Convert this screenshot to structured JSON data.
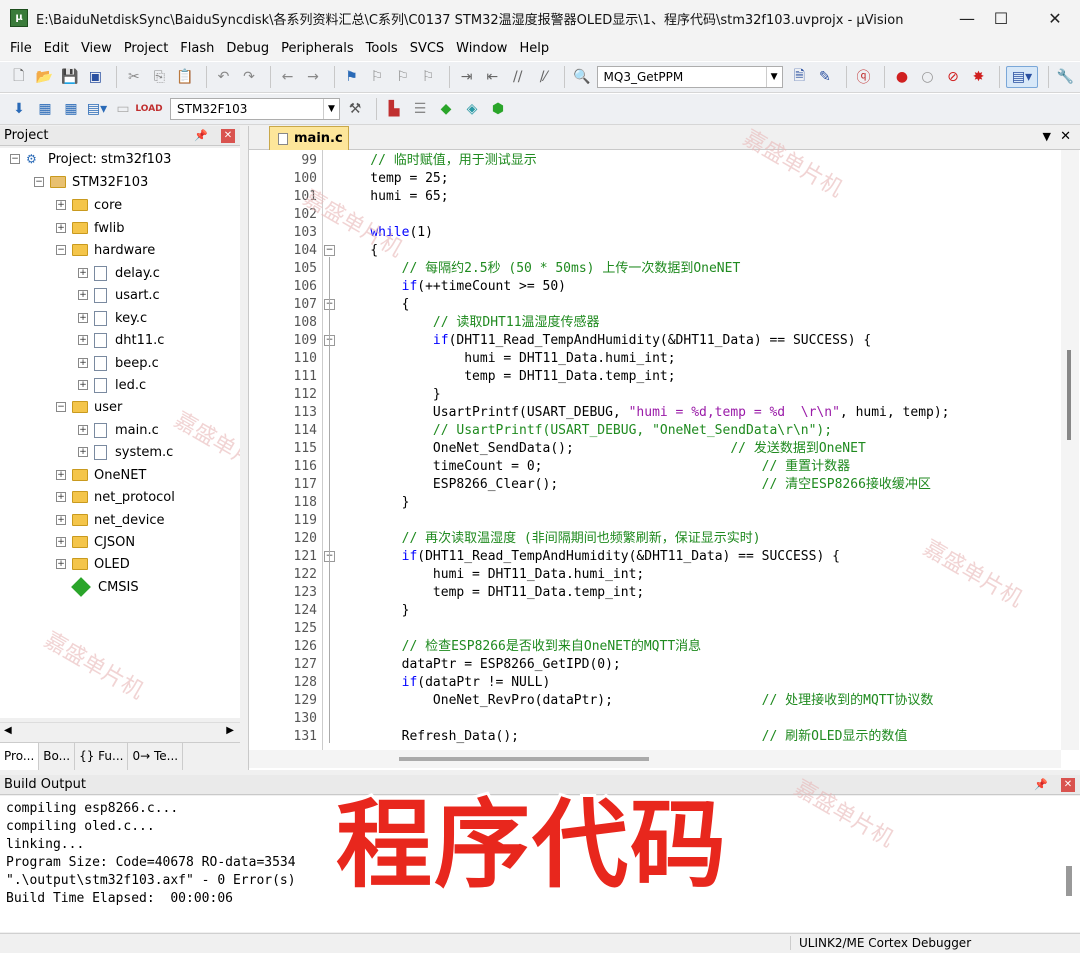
{
  "window": {
    "title": "E:\\BaiduNetdiskSync\\BaiduSyncdisk\\各系列资料汇总\\C系列\\C0137 STM32温湿度报警器OLED显示\\1、程序代码\\stm32f103.uvprojx - µVision",
    "minimize": "—",
    "maximize": "☐",
    "close": "✕"
  },
  "menu": [
    "File",
    "Edit",
    "View",
    "Project",
    "Flash",
    "Debug",
    "Peripherals",
    "Tools",
    "SVCS",
    "Window",
    "Help"
  ],
  "toolbar": {
    "find_combo": "MQ3_GetPPM",
    "target_combo": "STM32F103"
  },
  "project_panel": {
    "title": "Project",
    "root": "Project: stm32f103",
    "target": "STM32F103",
    "groups": {
      "core": "core",
      "fwlib": "fwlib",
      "hardware": "hardware",
      "hardware_files": [
        "delay.c",
        "usart.c",
        "key.c",
        "dht11.c",
        "beep.c",
        "led.c"
      ],
      "user": "user",
      "user_files": [
        "main.c",
        "system.c"
      ],
      "onenet": "OneNET",
      "net_protocol": "net_protocol",
      "net_device": "net_device",
      "cjson": "CJSON",
      "oled": "OLED",
      "cmsis": "CMSIS"
    },
    "tabs": [
      "Pro...",
      "Bo...",
      "{} Fu...",
      "0→ Te..."
    ]
  },
  "editor": {
    "tab": "main.c",
    "lines": [
      {
        "n": "99",
        "t": "    // 临时赋值，用于测试显示"
      },
      {
        "n": "100",
        "t": "    temp = 25;"
      },
      {
        "n": "101",
        "t": "    humi = 65;"
      },
      {
        "n": "102",
        "t": ""
      },
      {
        "n": "103",
        "t": "    while(1)"
      },
      {
        "n": "104",
        "t": "    {"
      },
      {
        "n": "105",
        "t": "        // 每隔约2.5秒 (50 * 50ms) 上传一次数据到OneNET"
      },
      {
        "n": "106",
        "t": "        if(++timeCount >= 50)"
      },
      {
        "n": "107",
        "t": "        {"
      },
      {
        "n": "108",
        "t": "            // 读取DHT11温湿度传感器"
      },
      {
        "n": "109",
        "t": "            if(DHT11_Read_TempAndHumidity(&DHT11_Data) == SUCCESS) {"
      },
      {
        "n": "110",
        "t": "                humi = DHT11_Data.humi_int;"
      },
      {
        "n": "111",
        "t": "                temp = DHT11_Data.temp_int;"
      },
      {
        "n": "112",
        "t": "            }"
      },
      {
        "n": "113",
        "t": "            UsartPrintf(USART_DEBUG, \"humi = %d,temp = %d  \\r\\n\", humi, temp);"
      },
      {
        "n": "114",
        "t": "            // UsartPrintf(USART_DEBUG, \"OneNet_SendData\\r\\n\");"
      },
      {
        "n": "115",
        "t": "            OneNet_SendData();                    // 发送数据到OneNET"
      },
      {
        "n": "116",
        "t": "            timeCount = 0;                            // 重置计数器"
      },
      {
        "n": "117",
        "t": "            ESP8266_Clear();                          // 清空ESP8266接收缓冲区"
      },
      {
        "n": "118",
        "t": "        }"
      },
      {
        "n": "119",
        "t": ""
      },
      {
        "n": "120",
        "t": "        // 再次读取温湿度 (非间隔期间也频繁刷新，保证显示实时)"
      },
      {
        "n": "121",
        "t": "        if(DHT11_Read_TempAndHumidity(&DHT11_Data) == SUCCESS) {"
      },
      {
        "n": "122",
        "t": "            humi = DHT11_Data.humi_int;"
      },
      {
        "n": "123",
        "t": "            temp = DHT11_Data.temp_int;"
      },
      {
        "n": "124",
        "t": "        }"
      },
      {
        "n": "125",
        "t": ""
      },
      {
        "n": "126",
        "t": "        // 检查ESP8266是否收到来自OneNET的MQTT消息"
      },
      {
        "n": "127",
        "t": "        dataPtr = ESP8266_GetIPD(0);"
      },
      {
        "n": "128",
        "t": "        if(dataPtr != NULL)"
      },
      {
        "n": "129",
        "t": "            OneNet_RevPro(dataPtr);                   // 处理接收到的MQTT协议数"
      },
      {
        "n": "130",
        "t": ""
      },
      {
        "n": "131",
        "t": "        Refresh_Data();                               // 刷新OLED显示的数值"
      }
    ]
  },
  "build_output": {
    "title": "Build Output",
    "lines": [
      "compiling esp8266.c...",
      "compiling oled.c...",
      "linking...",
      "Program Size: Code=40678 RO-data=3534",
      "\".\\output\\stm32f103.axf\" - 0 Error(s)",
      "Build Time Elapsed:  00:00:06"
    ]
  },
  "overlay_caption": "程序代码",
  "watermark": "嘉盛单片机",
  "status": {
    "debugger": "ULINK2/ME Cortex Debugger"
  }
}
